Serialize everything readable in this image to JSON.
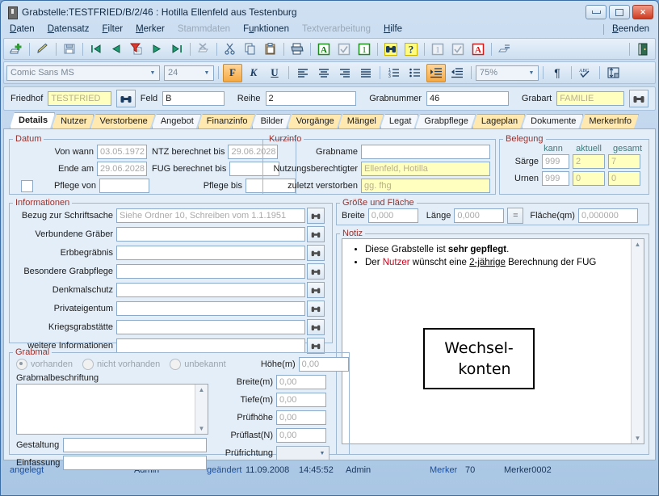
{
  "window": {
    "title": "Grabstelle:TESTFRIED/B/2/46 : Hotilla Ellenfeld aus Testenburg",
    "icon": "book-icon",
    "minimize": "minimize-icon",
    "maximize": "maximize-icon",
    "close": "close-icon"
  },
  "menu": {
    "items": [
      {
        "label": "Daten",
        "disabled": false
      },
      {
        "label": "Datensatz",
        "disabled": false
      },
      {
        "label": "Filter",
        "disabled": false
      },
      {
        "label": "Merker",
        "disabled": false
      },
      {
        "label": "Stammdaten",
        "disabled": true
      },
      {
        "label": "Funktionen",
        "disabled": false
      },
      {
        "label": "Textverarbeitung",
        "disabled": true
      },
      {
        "label": "Hilfe",
        "disabled": false
      }
    ],
    "right": {
      "label": "Beenden"
    }
  },
  "toolbar": {
    "buttons": [
      {
        "name": "new-record-icon",
        "sep_after": true
      },
      {
        "name": "edit-record-icon",
        "sep_after": true
      },
      {
        "name": "save-record-icon",
        "sep_after": true
      },
      {
        "name": "first-record-icon",
        "sep_after": false
      },
      {
        "name": "previous-record-icon",
        "sep_after": false
      },
      {
        "name": "filter-icon",
        "sep_after": false
      },
      {
        "name": "next-record-icon",
        "sep_after": false
      },
      {
        "name": "last-record-icon",
        "sep_after": true
      },
      {
        "name": "delete-record-icon",
        "sep_after": true
      },
      {
        "name": "cut-icon",
        "sep_after": false
      },
      {
        "name": "copy-icon",
        "sep_after": false
      },
      {
        "name": "paste-icon",
        "sep_after": true
      },
      {
        "name": "print-icon",
        "sep_after": true
      },
      {
        "name": "text-field-green-icon",
        "sep_after": false
      },
      {
        "name": "checkbox-field-icon",
        "sep_after": false
      },
      {
        "name": "number-field-green-icon",
        "sep_after": true
      },
      {
        "name": "search-binoculars-icon",
        "sep_after": false
      },
      {
        "name": "help-question-icon",
        "sep_after": true
      },
      {
        "name": "number-field-grey-icon",
        "sep_after": false
      },
      {
        "name": "checkbox-grey-icon",
        "sep_after": false
      },
      {
        "name": "text-field-red-icon",
        "sep_after": true
      },
      {
        "name": "properties-icon",
        "sep_after": false
      }
    ],
    "exit": {
      "name": "exit-door-icon"
    }
  },
  "format_toolbar": {
    "font_name": "Comic Sans MS",
    "font_size": "24",
    "zoom": "75%",
    "bold_label": "F",
    "italic_label": "K",
    "underline_label": "U",
    "buttons": [
      {
        "name": "align-left-icon"
      },
      {
        "name": "align-center-icon"
      },
      {
        "name": "align-right-icon"
      },
      {
        "name": "align-justify-icon"
      },
      {
        "name": "numbered-list-icon"
      },
      {
        "name": "bullet-list-icon"
      },
      {
        "name": "increase-indent-icon"
      },
      {
        "name": "decrease-indent-icon"
      },
      {
        "name": "paragraph-marks-icon"
      },
      {
        "name": "spellcheck-icon"
      },
      {
        "name": "line-spacing-icon"
      }
    ]
  },
  "keybar": {
    "friedhof_label": "Friedhof",
    "friedhof_value": "TESTFRIED",
    "feld_label": "Feld",
    "feld_value": "B",
    "reihe_label": "Reihe",
    "reihe_value": "2",
    "grabnummer_label": "Grabnummer",
    "grabnummer_value": "46",
    "grabart_label": "Grabart",
    "grabart_value": "FAMILIE"
  },
  "tabs": [
    {
      "label": "Details",
      "state": "active"
    },
    {
      "label": "Nutzer",
      "state": "highlight"
    },
    {
      "label": "Verstorbene",
      "state": "highlight"
    },
    {
      "label": "Angebot",
      "state": "plain"
    },
    {
      "label": "Finanzinfo",
      "state": "highlight"
    },
    {
      "label": "Bilder",
      "state": "plain"
    },
    {
      "label": "Vorgänge",
      "state": "highlight"
    },
    {
      "label": "Mängel",
      "state": "highlight"
    },
    {
      "label": "Legat",
      "state": "plain"
    },
    {
      "label": "Grabpflege",
      "state": "plain"
    },
    {
      "label": "Lageplan",
      "state": "highlight"
    },
    {
      "label": "Dokumente",
      "state": "plain"
    },
    {
      "label": "MerkerInfo",
      "state": "highlight"
    }
  ],
  "datum": {
    "legend": "Datum",
    "von_wann_label": "Von wann",
    "von_wann_value": "03.05.1972",
    "ntz_label": "NTZ berechnet bis",
    "ntz_value": "29.06.2028",
    "ende_am_label": "Ende am",
    "ende_am_value": "29.06.2028",
    "fug_label": "FUG berechnet bis",
    "fug_value": "",
    "pflege_von_label": "Pflege von",
    "pflege_von_value": "",
    "pflege_bis_label": "Pflege bis",
    "pflege_bis_value": ""
  },
  "kurzinfo": {
    "legend": "Kurzinfo",
    "grabname_label": "Grabname",
    "grabname_value": "",
    "nutzungsberechtigter_label": "Nutzungsberechtigter",
    "nutzungsberechtigter_value": "Ellenfeld, Hotilla",
    "zuletzt_label": "zuletzt verstorben",
    "zuletzt_value": "gg. fhg"
  },
  "belegung": {
    "legend": "Belegung",
    "col_kann": "kann",
    "col_aktuell": "aktuell",
    "col_gesamt": "gesamt",
    "rows": [
      {
        "label": "Särge",
        "kann": "999",
        "aktuell": "2",
        "gesamt": "7"
      },
      {
        "label": "Urnen",
        "kann": "999",
        "aktuell": "0",
        "gesamt": "0"
      }
    ]
  },
  "informationen": {
    "legend": "Informationen",
    "rows": [
      {
        "label": "Bezug zur Schriftsache",
        "value": "Siehe Ordner 10, Schreiben vom 1.1.1951"
      },
      {
        "label": "Verbundene Gräber",
        "value": ""
      },
      {
        "label": "Erbbegräbnis",
        "value": ""
      },
      {
        "label": "Besondere Grabpflege",
        "value": ""
      },
      {
        "label": "Denkmalschutz",
        "value": ""
      },
      {
        "label": "Privateigentum",
        "value": ""
      },
      {
        "label": "Kriegsgrabstätte",
        "value": ""
      },
      {
        "label": "weitere Informationen",
        "value": ""
      }
    ]
  },
  "groesse": {
    "legend": "Größe und Fläche",
    "breite_label": "Breite",
    "breite_value": "0,000",
    "laenge_label": "Länge",
    "laenge_value": "0,000",
    "equals_label": "=",
    "flaeche_label": "Fläche(qm)",
    "flaeche_value": "0,000000"
  },
  "notiz": {
    "legend": "Notiz",
    "line1_a": "Diese Grabstelle ist ",
    "line1_b": "sehr gepflegt",
    "line1_c": ".",
    "line2_a": "Der ",
    "line2_b": "Nutzer",
    "line2_c": " wünscht eine ",
    "line2_d": "2-jährige",
    "line2_e": " Berechnung der FUG",
    "box_line1": "Wechsel-",
    "box_line2": "konten"
  },
  "grabmal": {
    "legend": "Grabmal",
    "radio_vorhanden": "vorhanden",
    "radio_nicht_vorhanden": "nicht vorhanden",
    "radio_unbekannt": "unbekannt",
    "beschriftung_label": "Grabmalbeschriftung",
    "beschriftung_value": "",
    "gestaltung_label": "Gestaltung",
    "gestaltung_value": "",
    "einfassung_label": "Einfassung",
    "einfassung_value": "",
    "hoehe_label": "Höhe(m)",
    "hoehe_value": "0,00",
    "breite_label": "Breite(m)",
    "breite_value": "0,00",
    "tiefe_label": "Tiefe(m)",
    "tiefe_value": "0,00",
    "pruefhoehe_label": "Prüfhöhe",
    "pruefhoehe_value": "0,00",
    "prueflast_label": "Prüflast(N)",
    "prueflast_value": "0,00",
    "pruefrichtung_label": "Prüfrichtung",
    "pruefrichtung_value": ""
  },
  "statusbar": {
    "angelegt_label": "angelegt",
    "angelegt_date": "",
    "angelegt_user": "Admin",
    "geaendert_label": "geändert",
    "geaendert_date": "11.09.2008",
    "geaendert_time": "14:45:52",
    "geaendert_user": "Admin",
    "merker_label": "Merker",
    "merker_value": "70",
    "merker_id": "Merker0002"
  },
  "colors": {
    "accent": "#1a4fa0",
    "legend": "#99312b",
    "highlight_tab": "#ffe9b0",
    "yellow_field": "#ffffc0",
    "teal_header": "#3f7a7a",
    "red_text": "#d0021b"
  }
}
